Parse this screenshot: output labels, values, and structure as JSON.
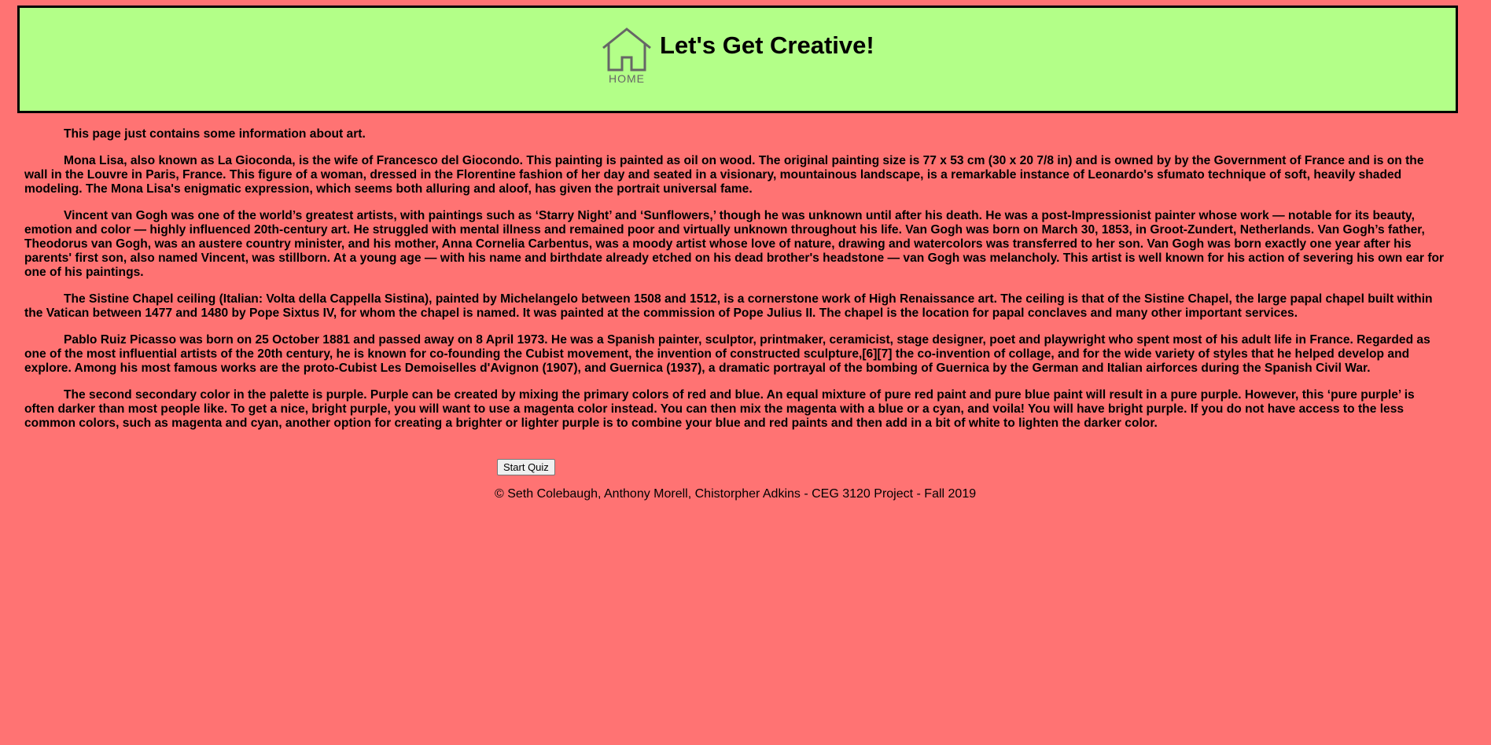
{
  "header": {
    "home_label": "HOME",
    "title": "Let's Get Creative!"
  },
  "content": {
    "intro": "This page just contains some information about art.",
    "paragraphs": [
      "Mona Lisa, also known as La Gioconda, is the wife of Francesco del Giocondo. This painting is painted as oil on wood. The original painting size is 77 x 53 cm (30 x 20 7/8 in) and is owned by by the Government of France and is on the wall in the Louvre in Paris, France. This figure of a woman, dressed in the Florentine fashion of her day and seated in a visionary, mountainous landscape, is a remarkable instance of Leonardo's sfumato technique of soft, heavily shaded modeling. The Mona Lisa's enigmatic expression, which seems both alluring and aloof, has given the portrait universal fame.",
      "Vincent van Gogh was one of the world’s greatest artists, with paintings such as ‘Starry Night’ and ‘Sunflowers,’ though he was unknown until after his death. He was a post-Impressionist painter whose work — notable for its beauty, emotion and color — highly influenced 20th-century art. He struggled with mental illness and remained poor and virtually unknown throughout his life. Van Gogh was born on March 30, 1853, in Groot-Zundert, Netherlands. Van Gogh’s father, Theodorus van Gogh, was an austere country minister, and his mother, Anna Cornelia Carbentus, was a moody artist whose love of nature, drawing and watercolors was transferred to her son. Van Gogh was born exactly one year after his parents' first son, also named Vincent, was stillborn. At a young age — with his name and birthdate already etched on his dead brother's headstone — van Gogh was melancholy. This artist is well known for his action of severing his own ear for one of his paintings.",
      "The Sistine Chapel ceiling (Italian: Volta della Cappella Sistina), painted by Michelangelo between 1508 and 1512, is a cornerstone work of High Renaissance art. The ceiling is that of the Sistine Chapel, the large papal chapel built within the Vatican between 1477 and 1480 by Pope Sixtus IV, for whom the chapel is named. It was painted at the commission of Pope Julius II. The chapel is the location for papal conclaves and many other important services.",
      "Pablo Ruiz Picasso was born on 25 October 1881 and passed away on 8 April 1973. He was a Spanish painter, sculptor, printmaker, ceramicist, stage designer, poet and playwright who spent most of his adult life in France. Regarded as one of the most influential artists of the 20th century, he is known for co-founding the Cubist movement, the invention of constructed sculpture,[6][7] the co-invention of collage, and for the wide variety of styles that he helped develop and explore. Among his most famous works are the proto-Cubist Les Demoiselles d'Avignon (1907), and Guernica (1937), a dramatic portrayal of the bombing of Guernica by the German and Italian airforces during the Spanish Civil War.",
      "The second secondary color in the palette is purple. Purple can be created by mixing the primary colors of red and blue. An equal mixture of pure red paint and pure blue paint will result in a pure purple. However, this ‘pure purple’ is often darker than most people like. To get a nice, bright purple, you will want to use a magenta color instead. You can then mix the magenta with a blue or a cyan, and voila! You will have bright purple. If you do not have access to the less common colors, such as magenta and cyan, another option for creating a brighter or lighter purple is to combine your blue and red paints and then add in a bit of white to lighten the darker color."
    ]
  },
  "actions": {
    "start_quiz_label": "Start Quiz"
  },
  "footer": {
    "text": "© Seth Colebaugh, Anthony Morell, Chistorpher Adkins - CEG 3120 Project - Fall 2019"
  },
  "colors": {
    "page_background": "#ff7373",
    "header_background": "#b3ff88",
    "header_border": "#000000",
    "home_icon": "#666666"
  },
  "icons": {
    "home": "house-icon"
  }
}
